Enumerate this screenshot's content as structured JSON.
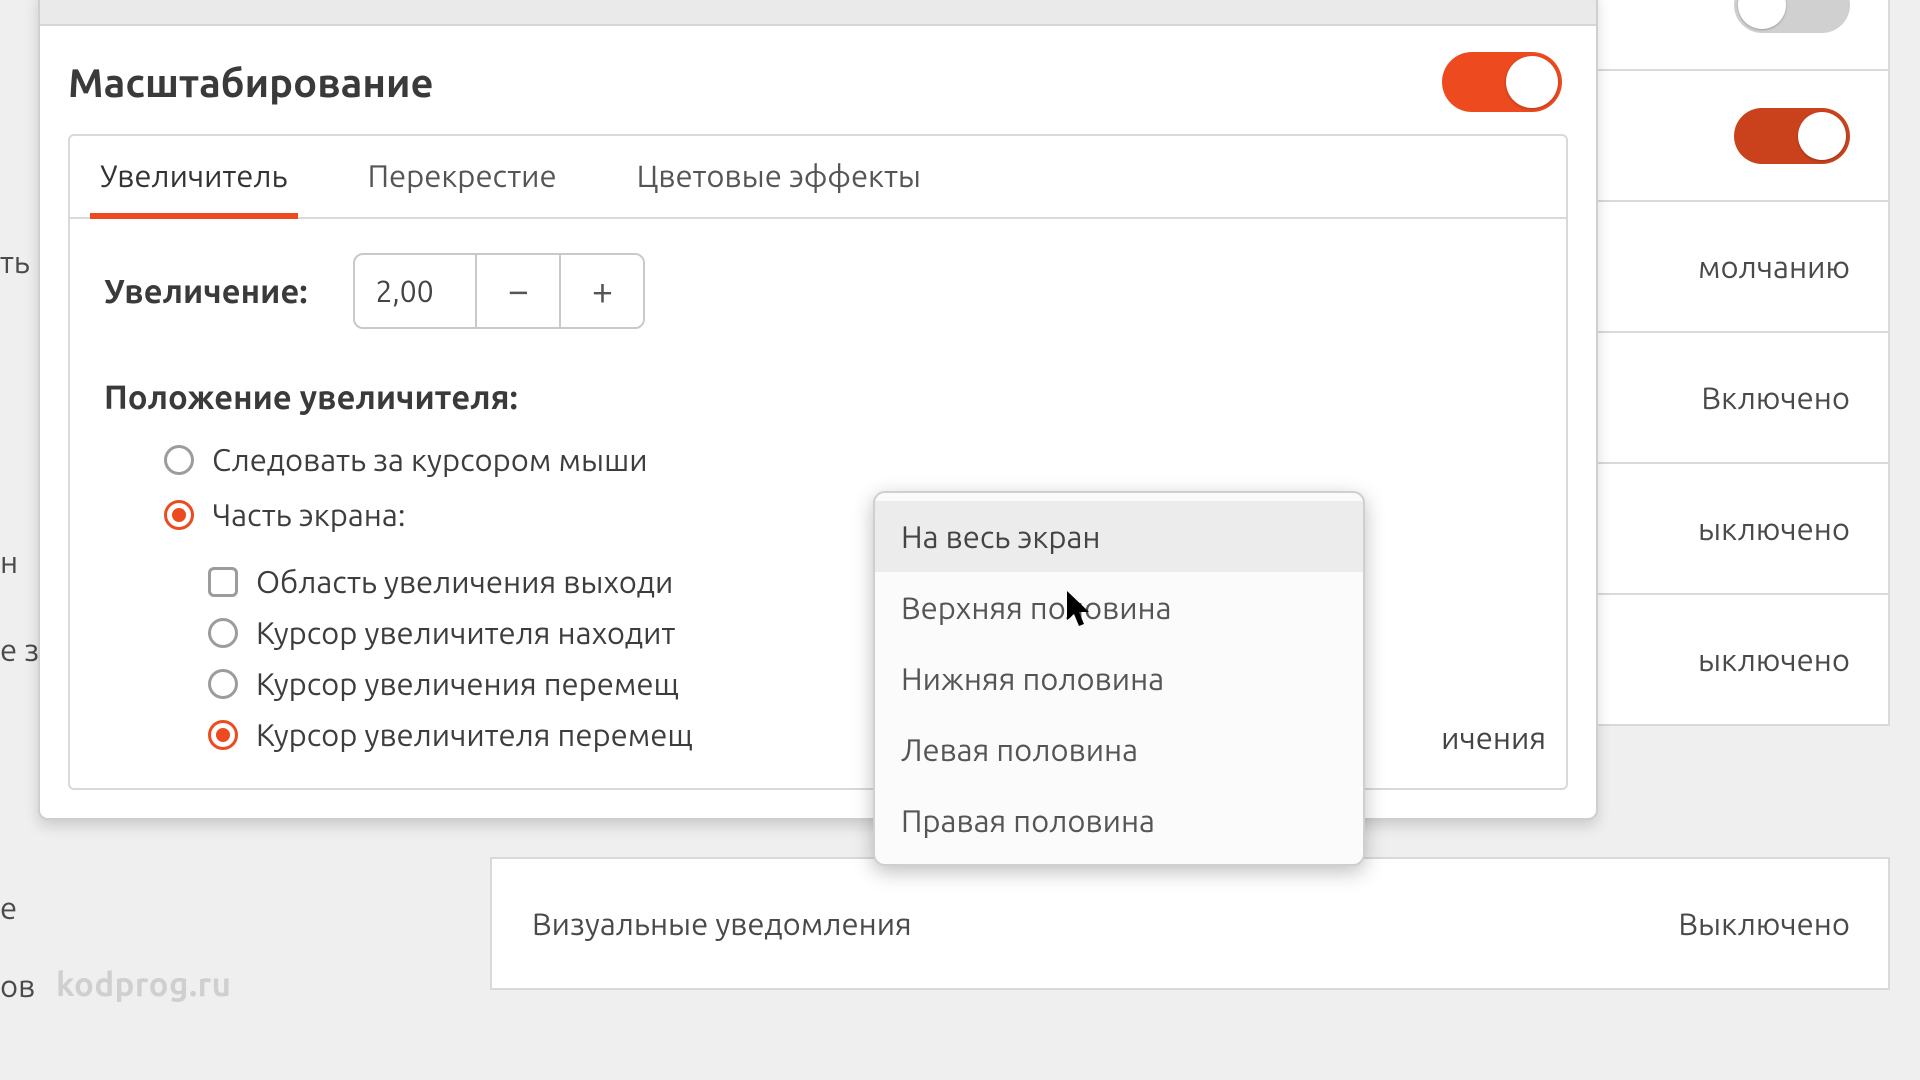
{
  "bg_rows": {
    "r0_label": "",
    "r1_label": "молчанию",
    "r2_label": "Включено",
    "r3_label": "ыключено",
    "r4_label": "ыключено",
    "row6_left": "Визуальные уведомления",
    "row6_right": "Выключено"
  },
  "left_frags": {
    "f1": "ть",
    "f2": "н",
    "f3": "е з",
    "f4": "е",
    "f5": "ов"
  },
  "dialog": {
    "title": "Масштабирование",
    "tabs": {
      "magnifier": "Увеличитель",
      "crosshair": "Перекрестие",
      "color": "Цветовые эффекты"
    },
    "mag_label": "Увеличение:",
    "mag_value": "2,00",
    "minus": "−",
    "plus": "+",
    "pos_title": "Положение увеличителя:",
    "opt_follow": "Следовать за курсором мыши",
    "opt_part": "Часть экрана:",
    "sub_overlap": "Область увеличения выходи",
    "sub_cursor_in": "Курсор увеличителя находит",
    "sub_cursor_move": "Курсор увеличения перемещ",
    "sub_cursor_move2": "Курсор увеличителя перемещ",
    "trail": "ичения"
  },
  "dropdown": {
    "i0": "На весь экран",
    "i1": "Верхняя половина",
    "i2": "Нижняя половина",
    "i3": "Левая половина",
    "i4": "Правая половина"
  },
  "watermark": "kodprog.ru"
}
